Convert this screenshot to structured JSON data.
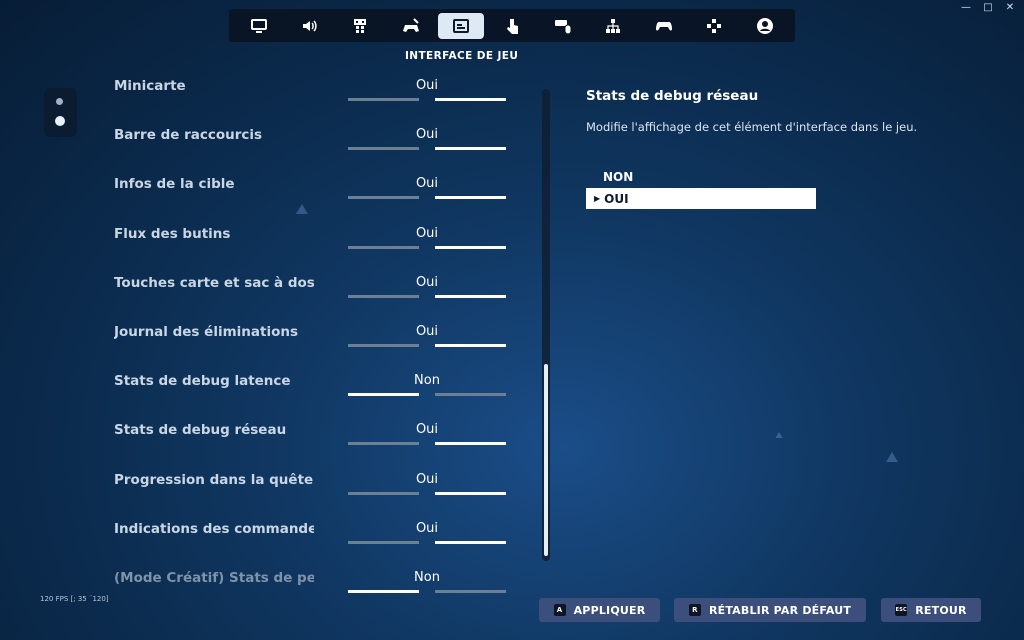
{
  "window_controls": {
    "minimize": "—",
    "maximize": "□",
    "close": "✕"
  },
  "nav": {
    "tabs": [
      {
        "icon": "monitor-icon",
        "active": false
      },
      {
        "icon": "speaker-icon",
        "active": false
      },
      {
        "icon": "accessibility-icon",
        "active": false
      },
      {
        "icon": "controller-link-icon",
        "active": false
      },
      {
        "icon": "game-ui-icon",
        "active": true
      },
      {
        "icon": "touch-icon",
        "active": false
      },
      {
        "icon": "keyboard-mouse-icon",
        "active": false
      },
      {
        "icon": "hierarchy-icon",
        "active": false
      },
      {
        "icon": "gamepad-icon",
        "active": false
      },
      {
        "icon": "dpad-icon",
        "active": false
      },
      {
        "icon": "account-icon",
        "active": false
      }
    ]
  },
  "section_title": "INTERFACE DE JEU",
  "settings": [
    {
      "label": "Minicarte",
      "value": "Oui",
      "on": "right"
    },
    {
      "label": "Barre de raccourcis",
      "value": "Oui",
      "on": "right"
    },
    {
      "label": "Infos de la cible",
      "value": "Oui",
      "on": "right"
    },
    {
      "label": "Flux des butins",
      "value": "Oui",
      "on": "right"
    },
    {
      "label": "Touches carte et sac à dos",
      "value": "Oui",
      "on": "right"
    },
    {
      "label": "Journal des éliminations",
      "value": "Oui",
      "on": "right"
    },
    {
      "label": "Stats de debug latence",
      "value": "Non",
      "on": "left"
    },
    {
      "label": "Stats de debug réseau",
      "value": "Oui",
      "on": "right"
    },
    {
      "label": "Progression dans la quête",
      "value": "Oui",
      "on": "right"
    },
    {
      "label": "Indications des commandes",
      "value": "Oui",
      "on": "right"
    },
    {
      "label": "(Mode Créatif) Stats de perfo",
      "value": "Non",
      "on": "left"
    }
  ],
  "detail": {
    "title": "Stats de debug réseau",
    "description": "Modifie l'affichage de cet élément d'interface dans le jeu.",
    "options": [
      "NON",
      "OUI"
    ],
    "selected": "OUI"
  },
  "fps": "120 FPS [; 35 ¨120]",
  "buttons": {
    "apply": {
      "key": "A",
      "label": "APPLIQUER"
    },
    "reset": {
      "key": "R",
      "label": "RÉTABLIR PAR DÉFAUT"
    },
    "back": {
      "key": "ESC",
      "label": "RETOUR"
    }
  },
  "colors": {
    "accent": "#ffffff",
    "background": "#0b2a4c",
    "button": "#3c4f7c",
    "inactive_segment": "#6c7f93"
  }
}
